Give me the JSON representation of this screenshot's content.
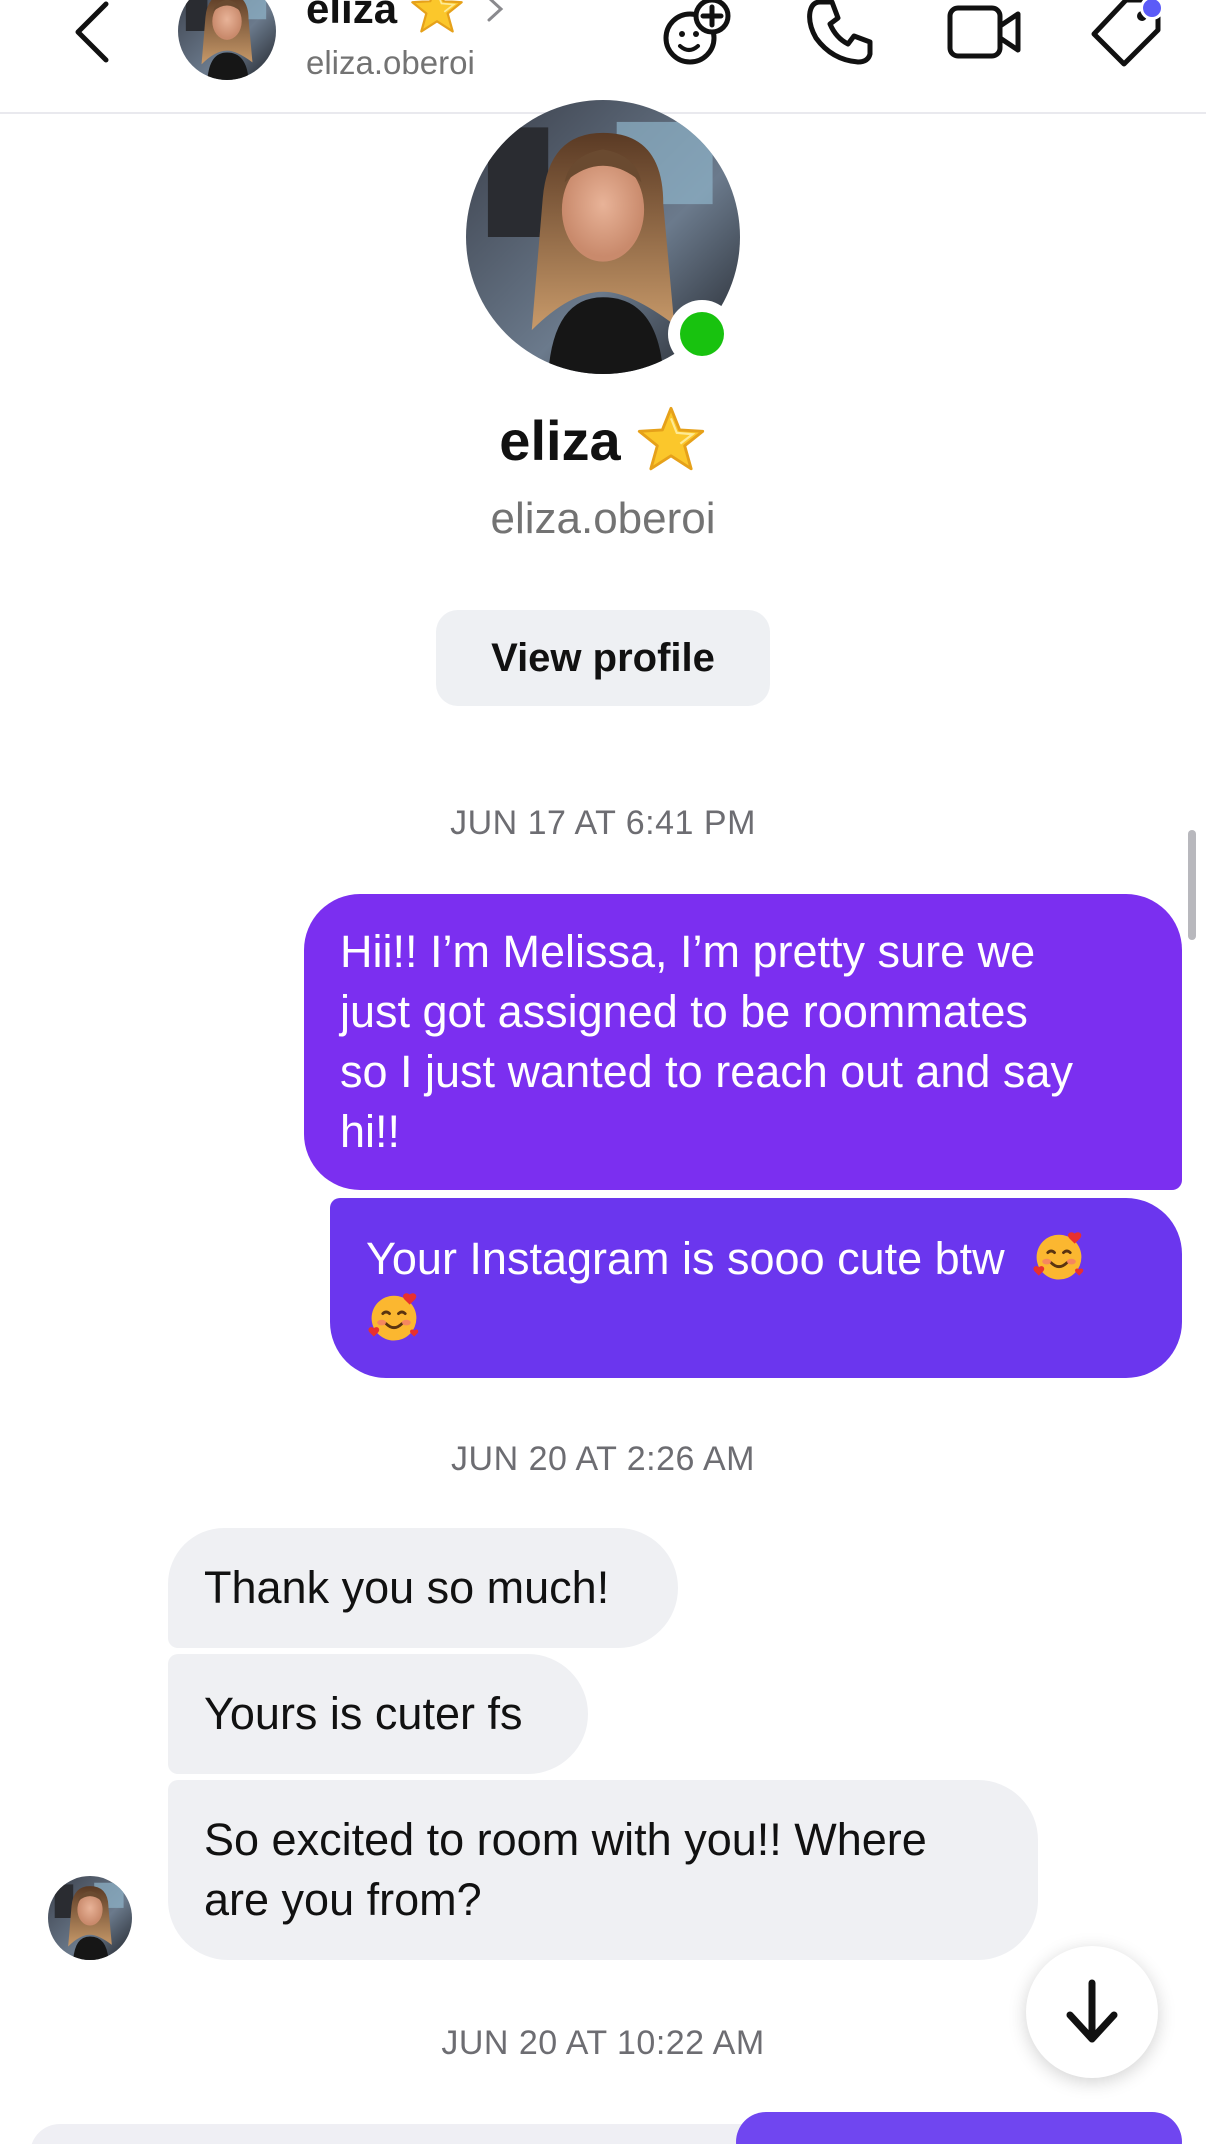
{
  "header": {
    "name": "eliza",
    "username": "eliza.oberoi",
    "icons": [
      "back-arrow-icon",
      "star-icon",
      "chevron-right-icon",
      "effects-icon",
      "phone-call-icon",
      "video-call-icon",
      "tag-icon"
    ],
    "notification_dot_color": "#5b5bf7"
  },
  "profile": {
    "name": "eliza",
    "username": "eliza.oberoi",
    "view_profile_label": "View profile",
    "online_color": "#18c20f"
  },
  "conversation": [
    {
      "timestamp": "JUN 17 AT 6:41 PM"
    },
    {
      "from": "me",
      "lines": [
        "Hii!! I’m Melissa, I’m pretty sure we",
        "just got assigned to be roommates",
        "so I just wanted to reach out and say",
        "hi!!"
      ]
    },
    {
      "from": "me",
      "lines": [
        "Your Instagram is sooo cute btw"
      ]
    },
    {
      "timestamp": "JUN 20 AT 2:26 AM"
    },
    {
      "from": "eliza",
      "lines": [
        "Thank you so much!"
      ]
    },
    {
      "from": "eliza",
      "lines": [
        "Yours is cuter fs"
      ]
    },
    {
      "from": "eliza",
      "lines": [
        "So excited to room with you!! Where",
        "are you from?"
      ]
    },
    {
      "timestamp": "JUN 20 AT 10:22 AM"
    }
  ],
  "colors": {
    "outgoing_bubble": "#7b2ff0",
    "outgoing_bubble_2": "#6b36ee",
    "incoming_bubble": "#eff0f3"
  }
}
